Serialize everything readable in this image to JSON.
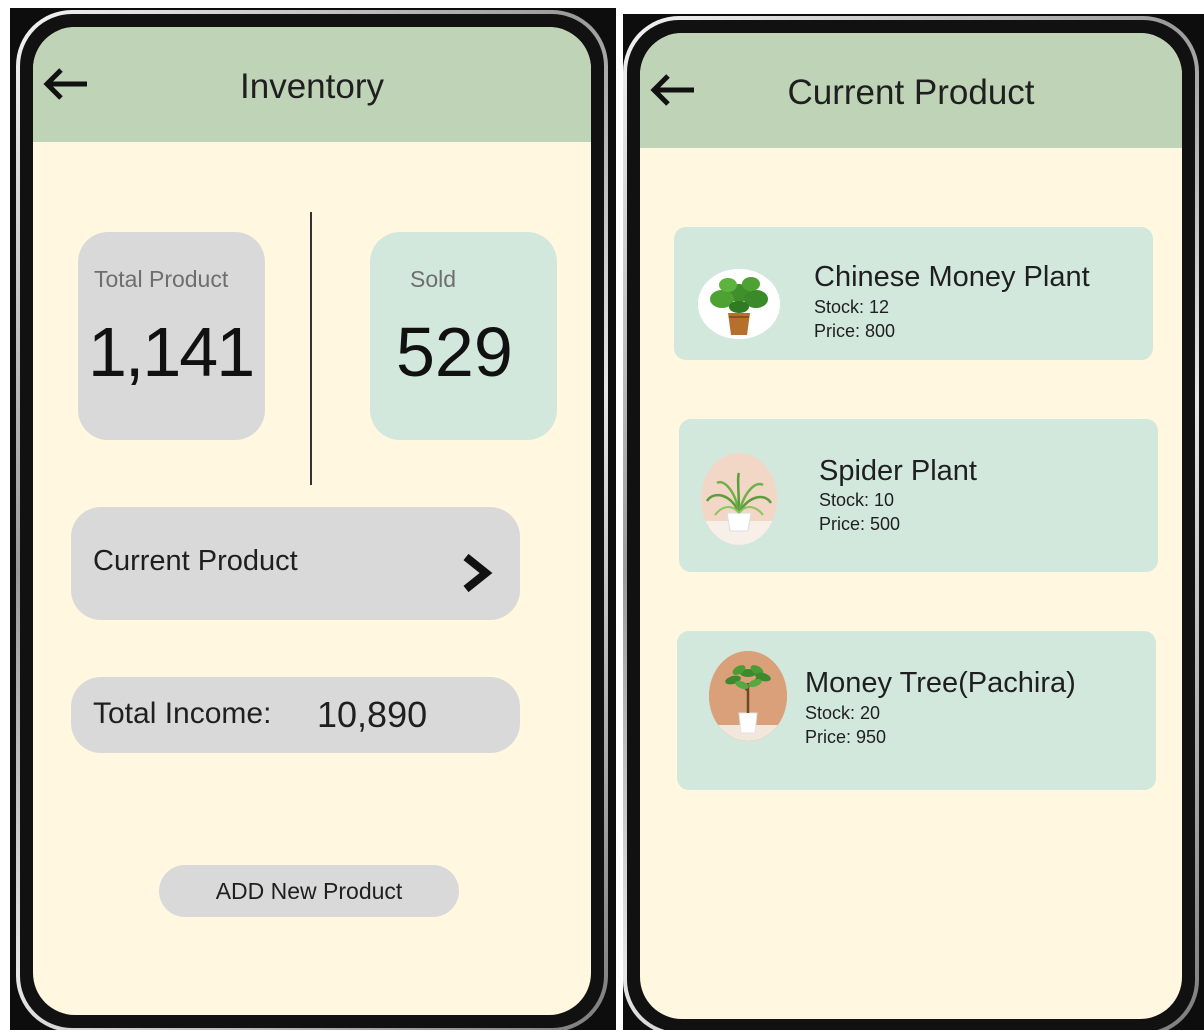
{
  "inventory_screen": {
    "title": "Inventory",
    "back_icon": "arrow-left-icon",
    "total_product": {
      "label": "Total Product",
      "value": "1,141"
    },
    "sold": {
      "label": "Sold",
      "value": "529"
    },
    "current_product_button": {
      "label": "Current Product",
      "icon": "chevron-right-icon"
    },
    "total_income": {
      "label": "Total Income:",
      "value": "10,890"
    },
    "add_button": {
      "label": "ADD New Product"
    },
    "colors": {
      "appbar": "#bfd3b7",
      "background": "#fff7df",
      "gray_card": "#d9d9d9",
      "green_card": "#d2e8dc"
    }
  },
  "current_product_screen": {
    "title": "Current Product",
    "back_icon": "arrow-left-icon",
    "products": [
      {
        "name": "Chinese Money Plant",
        "stock": "Stock: 12",
        "price": "Price: 800",
        "image_icon": "chinese-money-plant-image"
      },
      {
        "name": "Spider Plant",
        "stock": "Stock: 10",
        "price": "Price: 500",
        "image_icon": "spider-plant-image"
      },
      {
        "name": "Money Tree(Pachira)",
        "stock": "Stock: 20",
        "price": "Price: 950",
        "image_icon": "money-tree-image"
      }
    ]
  }
}
